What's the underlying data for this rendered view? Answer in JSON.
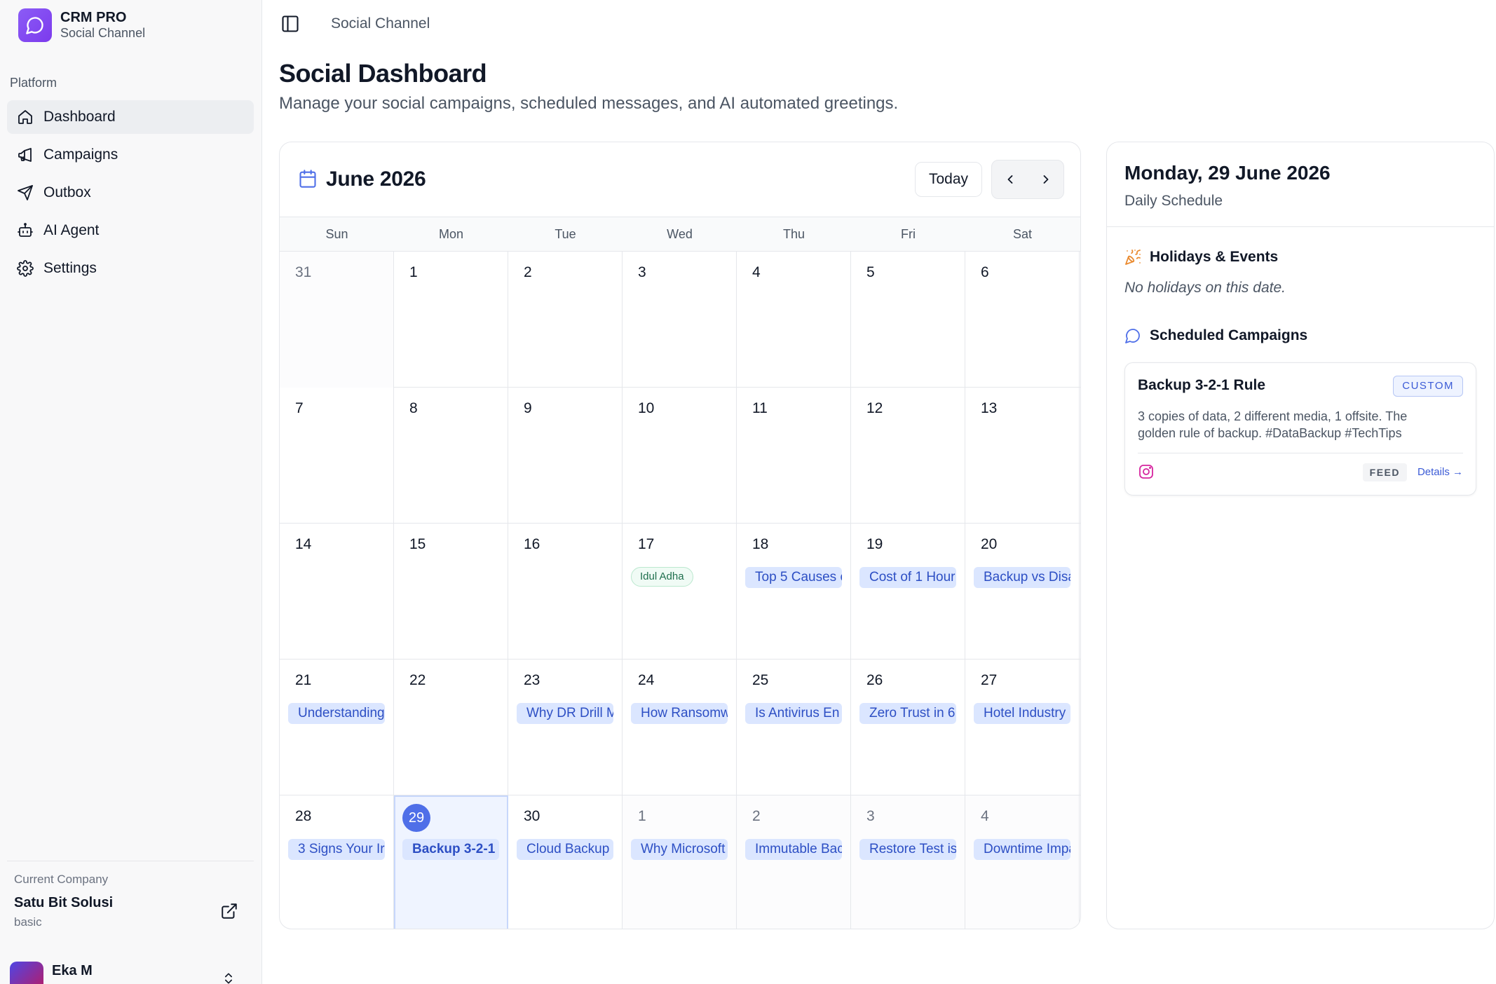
{
  "app": {
    "name": "CRM PRO",
    "subtitle": "Social Channel"
  },
  "sidebar": {
    "section_label": "Platform",
    "items": [
      {
        "label": "Dashboard",
        "icon": "home-icon",
        "active": true
      },
      {
        "label": "Campaigns",
        "icon": "megaphone-icon",
        "active": false
      },
      {
        "label": "Outbox",
        "icon": "send-icon",
        "active": false
      },
      {
        "label": "AI Agent",
        "icon": "bot-icon",
        "active": false
      },
      {
        "label": "Settings",
        "icon": "gear-icon",
        "active": false
      }
    ],
    "company": {
      "label": "Current Company",
      "name": "Satu Bit Solusi",
      "plan": "basic"
    },
    "user": {
      "name": "Eka M"
    }
  },
  "header": {
    "breadcrumb": "Social Channel",
    "title": "Social Dashboard",
    "subtitle": "Manage your social campaigns, scheduled messages, and AI automated greetings."
  },
  "calendar": {
    "month_label": "June 2026",
    "today_label": "Today",
    "weekdays": [
      "Sun",
      "Mon",
      "Tue",
      "Wed",
      "Thu",
      "Fri",
      "Sat"
    ],
    "weeks": [
      [
        {
          "day": "31",
          "out": true,
          "events": []
        },
        {
          "day": "1",
          "events": []
        },
        {
          "day": "2",
          "events": []
        },
        {
          "day": "3",
          "events": []
        },
        {
          "day": "4",
          "events": []
        },
        {
          "day": "5",
          "events": []
        },
        {
          "day": "6",
          "events": []
        }
      ],
      [
        {
          "day": "7",
          "events": []
        },
        {
          "day": "8",
          "events": []
        },
        {
          "day": "9",
          "events": []
        },
        {
          "day": "10",
          "events": []
        },
        {
          "day": "11",
          "events": []
        },
        {
          "day": "12",
          "events": []
        },
        {
          "day": "13",
          "events": []
        }
      ],
      [
        {
          "day": "14",
          "events": []
        },
        {
          "day": "15",
          "events": []
        },
        {
          "day": "16",
          "events": []
        },
        {
          "day": "17",
          "holiday": "Idul Adha",
          "events": []
        },
        {
          "day": "18",
          "events": [
            "Top 5 Causes c"
          ]
        },
        {
          "day": "19",
          "events": [
            "Cost of 1 Hour"
          ]
        },
        {
          "day": "20",
          "events": [
            "Backup vs Disa"
          ]
        }
      ],
      [
        {
          "day": "21",
          "events": [
            "Understanding"
          ]
        },
        {
          "day": "22",
          "events": []
        },
        {
          "day": "23",
          "events": [
            "Why DR Drill M"
          ]
        },
        {
          "day": "24",
          "events": [
            "How Ransomw"
          ]
        },
        {
          "day": "25",
          "events": [
            "Is Antivirus En"
          ]
        },
        {
          "day": "26",
          "events": [
            "Zero Trust in 6"
          ]
        },
        {
          "day": "27",
          "events": [
            "Hotel Industry"
          ]
        }
      ],
      [
        {
          "day": "28",
          "events": [
            "3 Signs Your Ir"
          ]
        },
        {
          "day": "29",
          "selected": true,
          "events": [
            "Backup 3-2-1"
          ]
        },
        {
          "day": "30",
          "events": [
            "Cloud Backup"
          ]
        },
        {
          "day": "1",
          "out": true,
          "events": [
            "Why Microsoft"
          ]
        },
        {
          "day": "2",
          "out": true,
          "events": [
            "Immutable Bac"
          ]
        },
        {
          "day": "3",
          "out": true,
          "events": [
            "Restore Test is"
          ]
        },
        {
          "day": "4",
          "out": true,
          "events": [
            "Downtime Impa"
          ]
        }
      ]
    ]
  },
  "panel": {
    "date": "Monday, 29 June 2026",
    "subtitle": "Daily Schedule",
    "holidays_title": "Holidays & Events",
    "no_holidays": "No holidays on this date.",
    "campaigns_title": "Scheduled Campaigns",
    "campaign": {
      "title": "Backup 3-2-1 Rule",
      "badge": "CUSTOM",
      "description": "3 copies of data, 2 different media, 1 offsite. The golden rule of backup. #DataBackup #TechTips",
      "channel_icon": "instagram-icon",
      "type": "FEED",
      "details": "Details →"
    }
  },
  "colors": {
    "accent": "#4f6fe8",
    "event_bg": "#dbe6ff",
    "event_text": "#2d4fc4",
    "brand": "#7c3aed",
    "instagram": "#d6249f"
  }
}
